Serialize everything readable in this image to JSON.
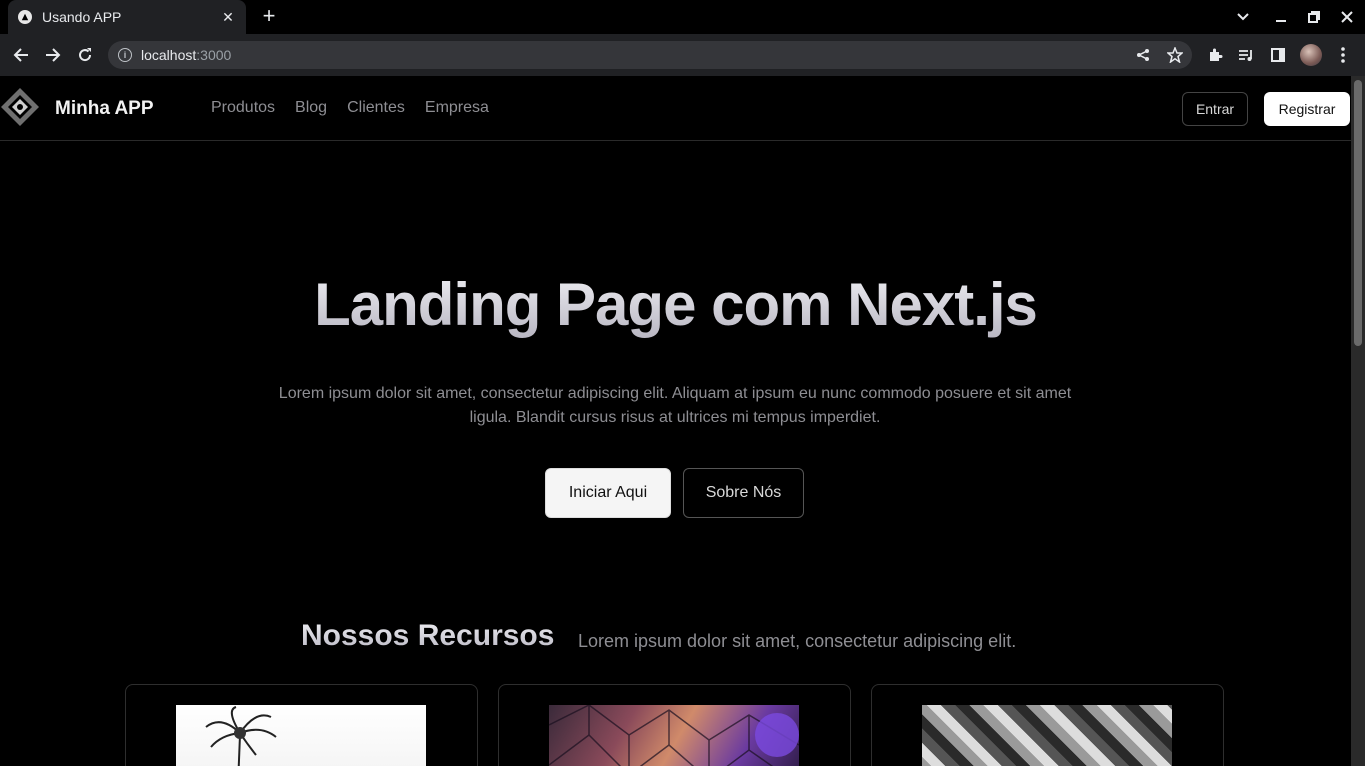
{
  "browser": {
    "tab_title": "Usando APP",
    "url_host": "localhost",
    "url_port": ":3000"
  },
  "header": {
    "brand": "Minha APP",
    "nav": [
      "Produtos",
      "Blog",
      "Clientes",
      "Empresa"
    ],
    "login": "Entrar",
    "register": "Registrar"
  },
  "hero": {
    "title": "Landing Page com Next.js",
    "subtitle": "Lorem ipsum dolor sit amet, consectetur adipiscing elit. Aliquam at ipsum eu nunc commodo posuere et sit amet ligula. Blandit cursus risus at ultrices mi tempus imperdiet.",
    "primary_button": "Iniciar Aqui",
    "secondary_button": "Sobre Nós"
  },
  "features": {
    "title": "Nossos Recursos",
    "subtitle": "Lorem ipsum dolor sit amet, consectetur adipiscing elit."
  }
}
